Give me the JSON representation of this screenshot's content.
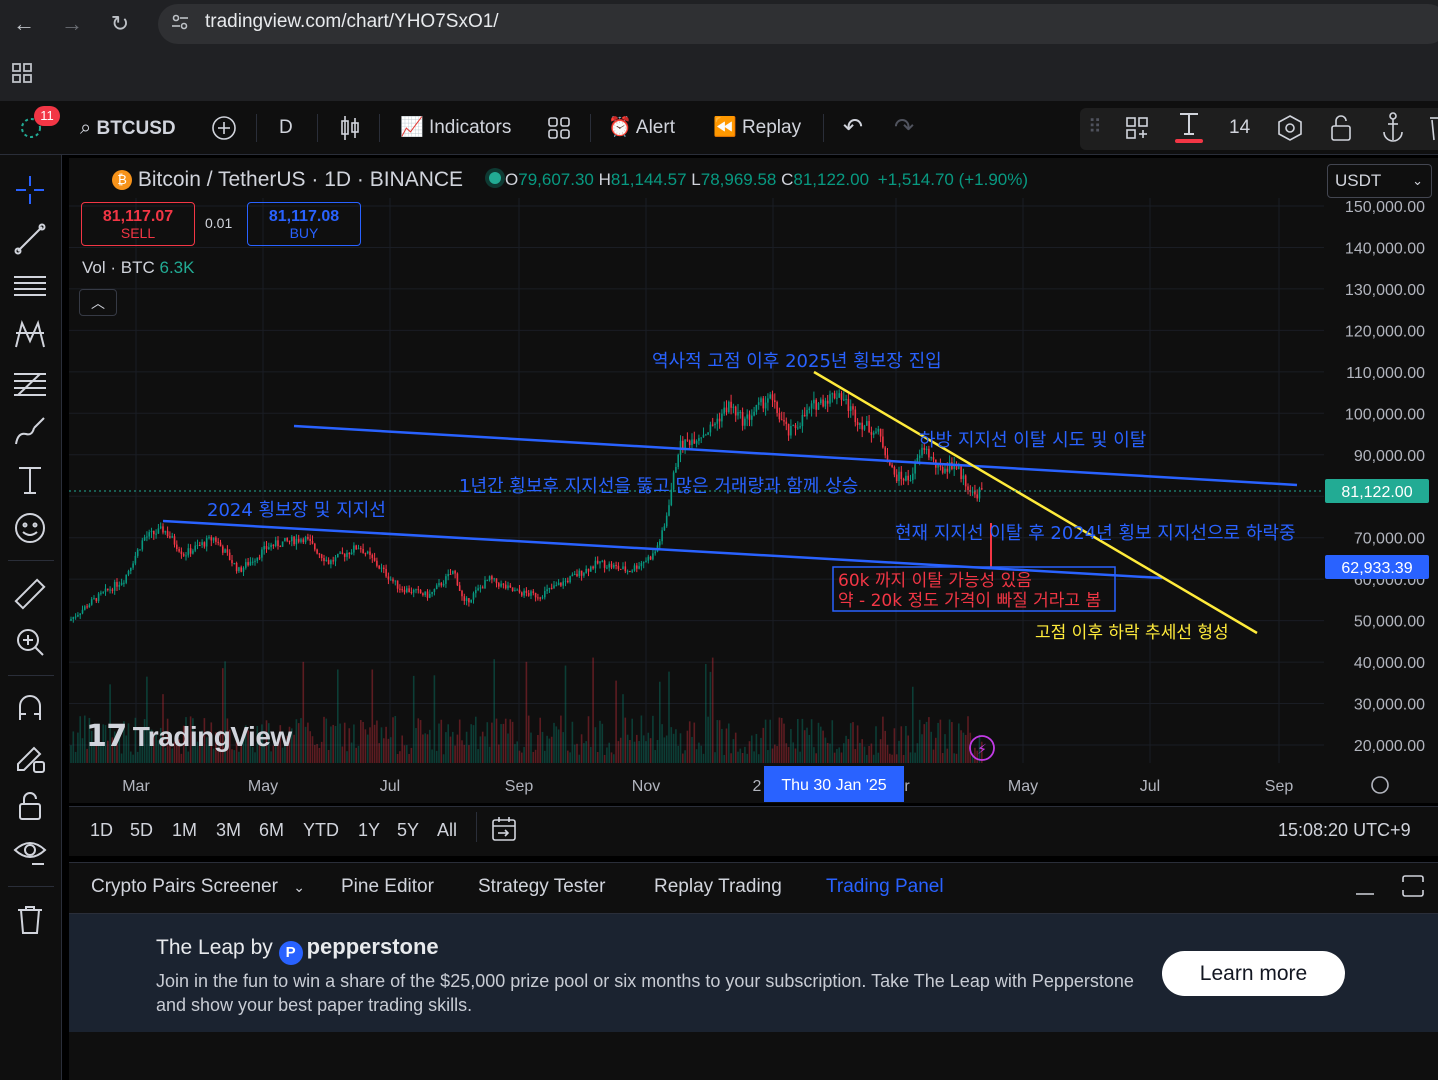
{
  "browser": {
    "url": "tradingview.com/chart/YHO7SxO1/"
  },
  "toolbar": {
    "notifications": "11",
    "symbol": "BTCUSD",
    "interval": "D",
    "indicators": "Indicators",
    "alert": "Alert",
    "replay": "Replay",
    "font_size": "14"
  },
  "legend": {
    "title": "Bitcoin / TetherUS · 1D · BINANCE",
    "o_label": "O",
    "o": "79,607.30",
    "h_label": "H",
    "h": "81,144.57",
    "l_label": "L",
    "l": "78,969.58",
    "c_label": "C",
    "c": "81,122.00",
    "change": "+1,514.70 (+1.90%)",
    "sell_price": "81,117.07",
    "sell": "SELL",
    "spread": "0.01",
    "buy_price": "81,117.08",
    "buy": "BUY",
    "vol_label": "Vol · BTC",
    "vol_value": "6.3K"
  },
  "currency": "USDT",
  "price_axis": [
    "150,000.00",
    "140,000.00",
    "130,000.00",
    "120,000.00",
    "110,000.00",
    "100,000.00",
    "90,000.00",
    "70,000.00",
    "60,000.00",
    "50,000.00",
    "40,000.00",
    "30,000.00",
    "20,000.00"
  ],
  "price_labels": {
    "current": "81,122.00",
    "marker": "62,933.39"
  },
  "time_axis": [
    "Mar",
    "May",
    "Jul",
    "Sep",
    "Nov",
    "2",
    "r",
    "May",
    "Jul",
    "Sep"
  ],
  "crosshair_date": "Thu 30 Jan '25",
  "annotations": {
    "top": "역사적 고점 이후 2025년 횡보장 진입",
    "break_try": "하방 지지선 이탈 시도 및 이탈",
    "rise": "1년간 횡보후 지지선을 뚫고 많은 거래량과 함께 상승",
    "range2024": "2024 횡보장 및 지지선",
    "current": "현재 지지선 이탈 후 2024년 횡보 지지선으로 하락중",
    "box_line1": "60k 까지 이탈 가능성 있음",
    "box_line2": "약 - 20k 정도 가격이 빠질 거라고 봄",
    "trend": "고점 이후 하락 추세선 형성"
  },
  "logo": "TradingView",
  "ranges": [
    "1D",
    "5D",
    "1M",
    "3M",
    "6M",
    "YTD",
    "1Y",
    "5Y",
    "All"
  ],
  "clock": "15:08:20 UTC+9",
  "tabs": [
    "Crypto Pairs Screener",
    "Pine Editor",
    "Strategy Tester",
    "Replay Trading",
    "Trading Panel"
  ],
  "promo": {
    "title_prefix": "The Leap by",
    "brand": "pepperstone",
    "body": "Join in the fun to win a share of the $25,000 prize pool or six months to your subscription. Take The Leap with Pepperstone and show your best paper trading skills.",
    "cta": "Learn more"
  },
  "colors": {
    "up": "#089981",
    "down": "#f23645",
    "accent": "#2962ff",
    "trendline": "#ffeb3b",
    "support": "#2962ff"
  }
}
